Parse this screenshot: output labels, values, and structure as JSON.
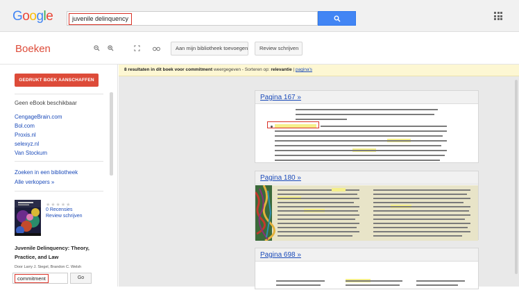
{
  "header": {
    "logo_letters": [
      "G",
      "o",
      "o",
      "g",
      "l",
      "e"
    ],
    "logo_colors": [
      "#4285f4",
      "#ea4335",
      "#fbbc05",
      "#4285f4",
      "#34a853",
      "#ea4335"
    ],
    "search_value": "juvenile delinquency",
    "search_icon": "search-icon"
  },
  "toolbar": {
    "section_title": "Boeken",
    "zoom_out_icon": "zoom-out-icon",
    "zoom_in_icon": "zoom-in-icon",
    "fullscreen_icon": "fullscreen-icon",
    "link_icon": "link-icon",
    "add_library_label": "Aan mijn bibliotheek toevoegen",
    "review_label": "Review schrijven"
  },
  "sidebar": {
    "buy_button": "GEDRUKT BOEK AANSCHAFFEN",
    "no_ebook": "Geen eBook beschikbaar",
    "stores": [
      "CengageBrain.com",
      "Bol.com",
      "Proxis.nl",
      "selexyz.nl",
      "Van Stockum"
    ],
    "library_link": "Zoeken in een bibliotheek",
    "all_sellers": "Alle verkopers »",
    "reviews_count": "0 Recensies",
    "write_review": "Review schrijven",
    "book_title": "Juvenile Delinquency: Theory, Practice, and Law",
    "authors": "Door Larry J. Siegel, Brandon C. Welsh",
    "in_book_search": "commitment",
    "go_label": "Go"
  },
  "results": {
    "prefix": "8 resultaten in dit boek voor",
    "term": "commitment",
    "middle": "weergegeven - Sorteren op:",
    "sort_active": "relevantie",
    "separator": "|",
    "sort_other": "pagina's"
  },
  "pages": [
    {
      "label": "Pagina 167 »",
      "highlight_color": "#f5ef8a"
    },
    {
      "label": "Pagina 180 »",
      "highlight_color": "#f5ef8a"
    },
    {
      "label": "Pagina 698 »",
      "highlight_color": "#f5ef8a"
    }
  ],
  "accent_color": "#dd4b39",
  "link_color": "#1a4ab9"
}
